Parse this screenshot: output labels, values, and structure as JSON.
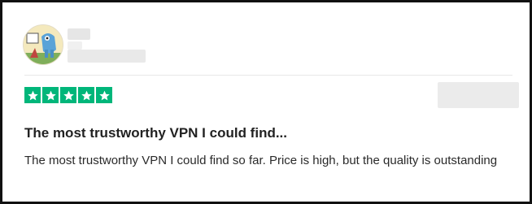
{
  "review": {
    "rating": 5,
    "rating_max": 5,
    "star_color": "#00b67a",
    "title": "The most trustworthy VPN I could find...",
    "body": "The most trustworthy VPN I could find so far. Price is high, but the quality is outstanding"
  },
  "icons": {
    "star": "star-icon",
    "avatar": "cartoon-avatar"
  }
}
